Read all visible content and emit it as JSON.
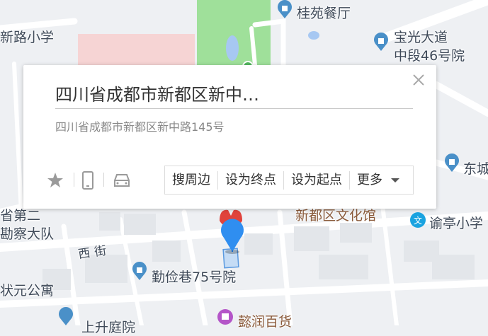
{
  "map": {
    "labels": {
      "guiyuan": "桂苑餐厅",
      "xinlu_school": "新路小学",
      "baoguang": "宝光大道",
      "baoguang2": "中段46号院",
      "dongcheng": "东城",
      "yuting": "谕亭小学",
      "xinduqu_wenhua": "新都区文化馆",
      "sheng": "省第二",
      "kancha": "勘察大队",
      "xijie": "西街",
      "qinjian": "勤俭巷75号院",
      "zhuangyuan": "状元公寓",
      "yirun": "懿润百货",
      "shangsheng": "上升庭院"
    },
    "colors": {
      "park": "#9fe09a",
      "school_area": "#f6d4d4",
      "road": "#ffffff",
      "poi_blue": "#4a90c8",
      "marker_blue": "#2f8ef0",
      "marker_red": "#e0433c"
    }
  },
  "popup": {
    "title": "四川省成都市新都区新中…",
    "address": "四川省成都市新都区新中路145号",
    "actions": {
      "search_nearby": "搜周边",
      "set_end": "设为终点",
      "set_start": "设为起点",
      "more": "更多"
    },
    "icons": [
      "star-icon",
      "phone-icon",
      "car-icon",
      "close-icon"
    ]
  }
}
